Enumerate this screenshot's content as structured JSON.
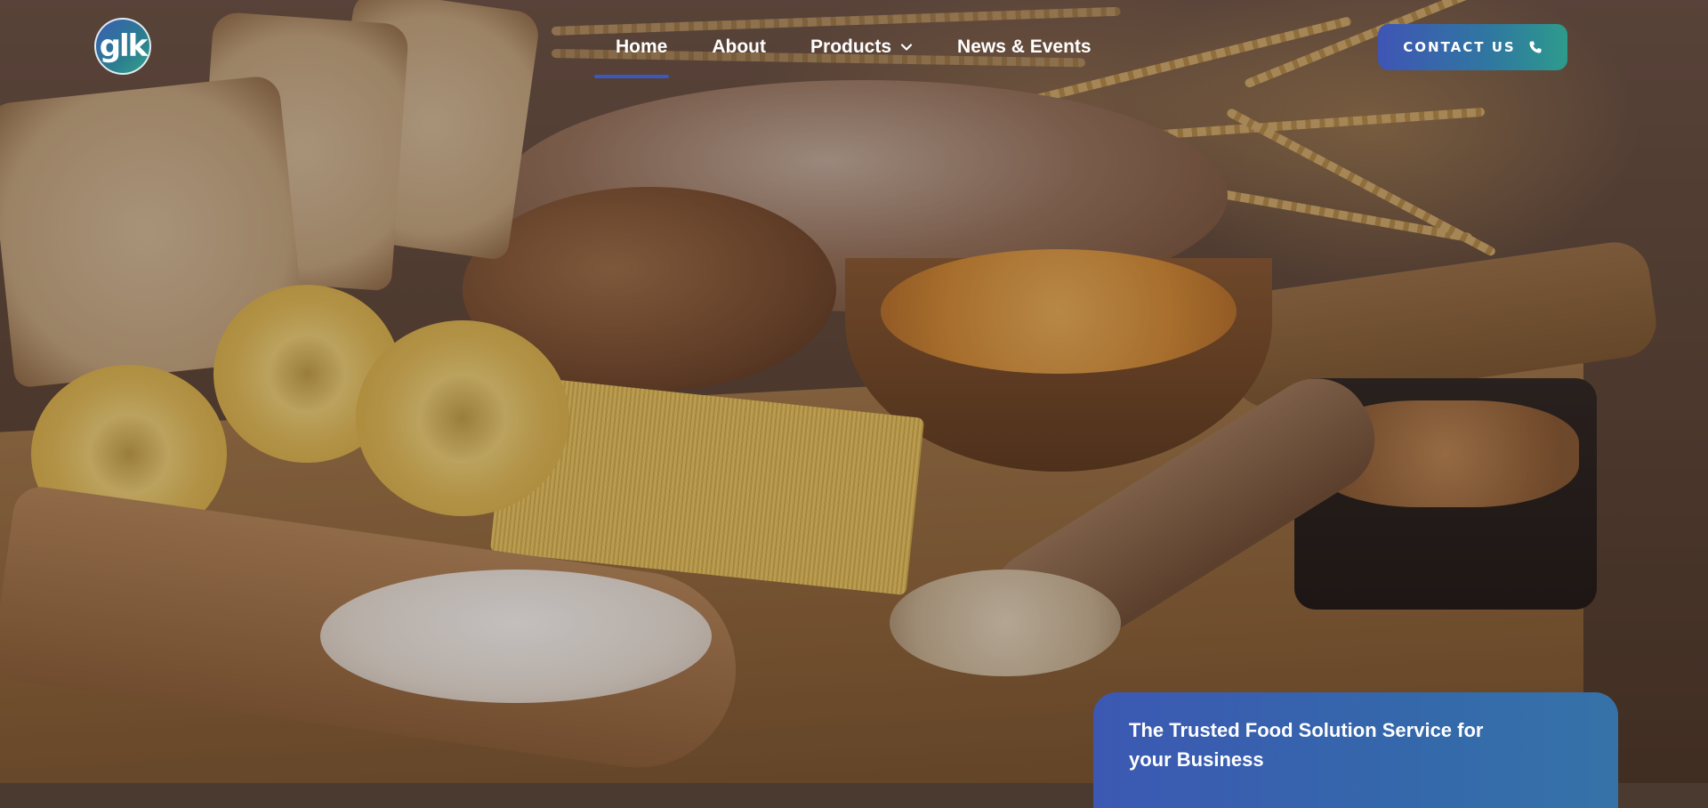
{
  "logo": {
    "text": "glk"
  },
  "nav": {
    "items": [
      {
        "label": "Home",
        "active": true
      },
      {
        "label": "About",
        "active": false
      },
      {
        "label": "Products",
        "active": false,
        "has_dropdown": true
      },
      {
        "label": "News & Events",
        "active": false
      }
    ]
  },
  "contact_button": {
    "label": "CONTACT US",
    "icon": "phone-icon"
  },
  "hero": {
    "card_title": "The Trusted Food Solution Service for your Business"
  },
  "colors": {
    "accent": "#3c58b8",
    "button_gradient_start": "#3f55b5",
    "button_gradient_end": "#2e9b8c"
  }
}
